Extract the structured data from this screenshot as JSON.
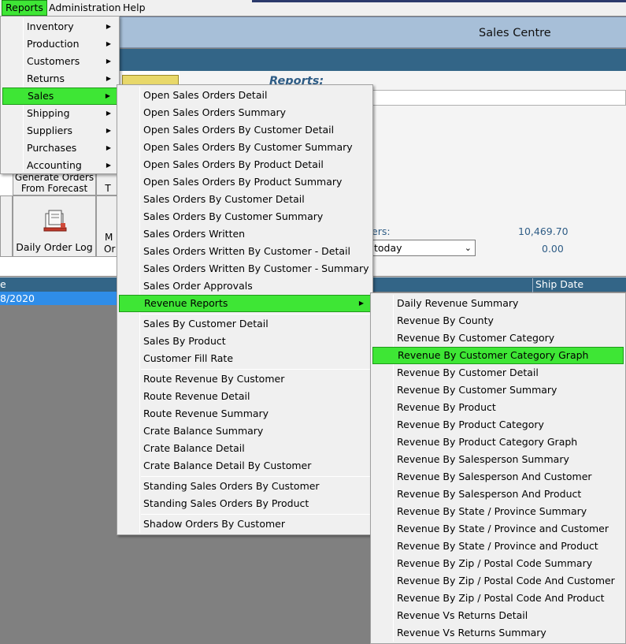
{
  "menubar": {
    "items": [
      "Reports",
      "Administration",
      "Help"
    ]
  },
  "app": {
    "title": "Sales Centre"
  },
  "panel": {
    "reports_heading": "Reports:",
    "buttons": {
      "generate_line1": "Generate Orders",
      "generate_line2": "From Forecast",
      "t_fragment": "T",
      "daily_order_log": "Daily Order Log",
      "m_fragment": "M",
      "or_fragment": "Or"
    },
    "stats": {
      "label_fragment": "ers:",
      "value1": "10,469.70",
      "select_value": "today",
      "value2": "0.00"
    }
  },
  "grid": {
    "col_left_fragment": "e",
    "col_ship": "Ship Date",
    "row1_date_fragment": "8/2020"
  },
  "menu_reports": {
    "items": [
      "Inventory",
      "Production",
      "Customers",
      "Returns",
      "Sales",
      "Shipping",
      "Suppliers",
      "Purchases",
      "Accounting"
    ],
    "highlighted": "Sales"
  },
  "menu_sales": {
    "group1": [
      "Open Sales Orders Detail",
      "Open Sales Orders Summary",
      "Open Sales Orders By Customer Detail",
      "Open Sales Orders By Customer Summary",
      "Open Sales Orders By Product Detail",
      "Open Sales Orders By Product Summary",
      "Sales Orders By Customer Detail",
      "Sales Orders By Customer Summary",
      "Sales Orders Written",
      "Sales Orders Written By Customer - Detail",
      "Sales Orders Written By Customer - Summary",
      "Sales Order Approvals",
      "Revenue Reports"
    ],
    "group2": [
      "Sales By Customer Detail",
      "Sales By Product",
      "Customer Fill Rate"
    ],
    "group3": [
      "Route Revenue By Customer",
      "Route Revenue Detail",
      "Route Revenue Summary",
      "Crate Balance Summary",
      "Crate Balance Detail",
      "Crate Balance Detail By Customer"
    ],
    "group4": [
      "Standing Sales Orders By Customer",
      "Standing Sales Orders By Product"
    ],
    "group5": [
      "Shadow Orders By Customer"
    ],
    "highlighted": "Revenue Reports"
  },
  "menu_revenue": {
    "items": [
      "Daily Revenue Summary",
      "Revenue By County",
      "Revenue By Customer Category",
      "Revenue By Customer Category Graph",
      "Revenue By Customer Detail",
      "Revenue By Customer Summary",
      "Revenue By Product",
      "Revenue By Product Category",
      "Revenue By Product Category Graph",
      "Revenue By Salesperson Summary",
      "Revenue By Salesperson And Customer",
      "Revenue By Salesperson And Product",
      "Revenue By State / Province Summary",
      "Revenue By State / Province and Customer",
      "Revenue By State / Province and Product",
      "Revenue By Zip / Postal Code Summary",
      "Revenue By Zip / Postal Code And Customer",
      "Revenue By Zip / Postal Code And Product",
      "Revenue Vs Returns Detail",
      "Revenue Vs Returns Summary"
    ],
    "highlighted": "Revenue By Customer Category Graph"
  },
  "colors": {
    "highlight": "#3ee635",
    "nav": "#336587",
    "titlebar": "#a7bfd8",
    "selection": "#2f8de8"
  },
  "icons": [
    "submenu-arrow-icon",
    "dropdown-chevron-icon",
    "daily-order-log-icon",
    "folder-icon"
  ]
}
